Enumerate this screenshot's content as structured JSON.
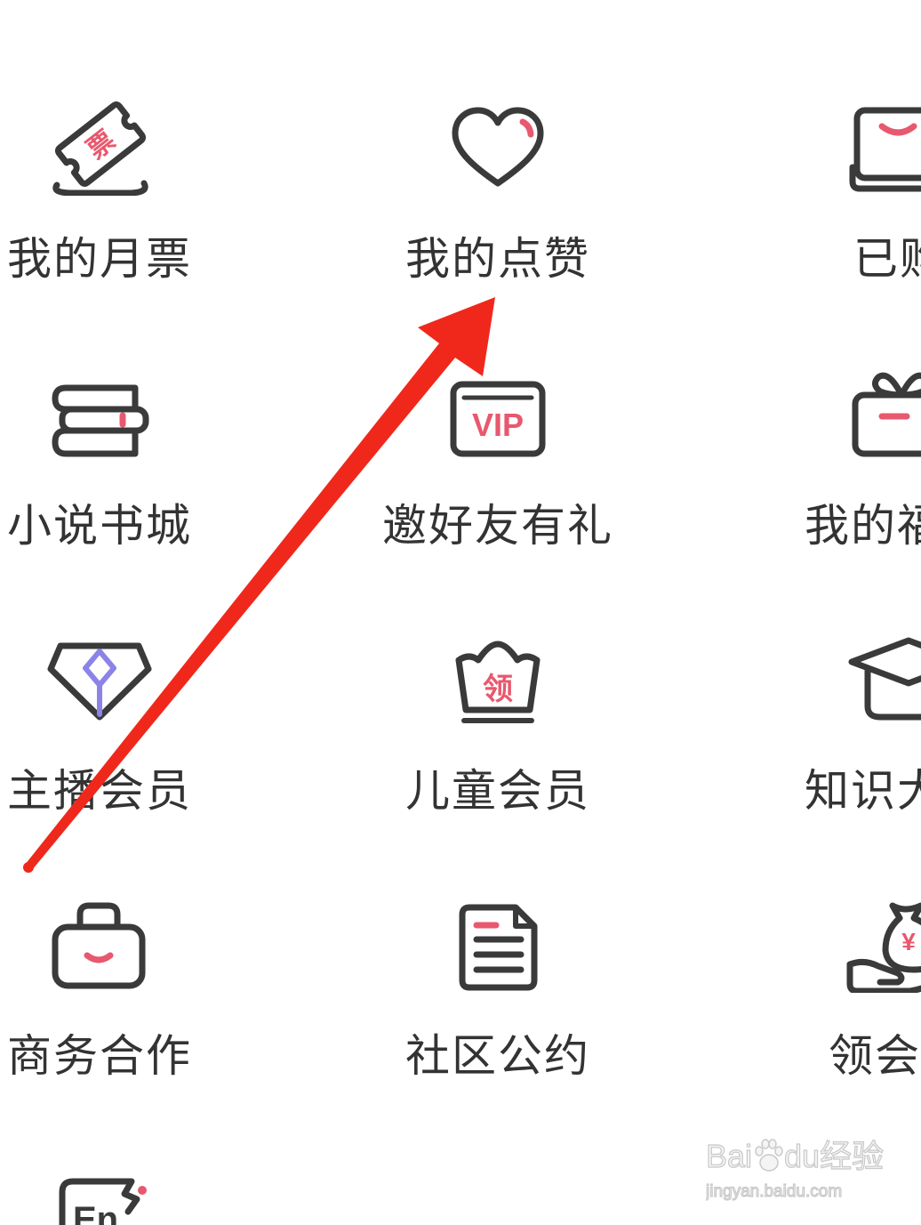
{
  "colors": {
    "stroke": "#3a3a3a",
    "accent": "#e8586e",
    "purple": "#8c83e8",
    "arrow": "#f0281c",
    "text": "#333333",
    "watermark": "#c9c9c9"
  },
  "menu": {
    "items": [
      {
        "label": "我的月票",
        "icon": "ticket-icon",
        "badge": "票"
      },
      {
        "label": "我的点赞",
        "icon": "heart-icon"
      },
      {
        "label": "已购",
        "icon": "purchased-book-icon"
      },
      {
        "label": "小说书城",
        "icon": "books-icon"
      },
      {
        "label": "邀好友有礼",
        "icon": "vip-card-icon",
        "badge": "VIP"
      },
      {
        "label": "我的福",
        "icon": "gift-icon"
      },
      {
        "label": "主播会员",
        "icon": "diamond-icon"
      },
      {
        "label": "儿童会员",
        "icon": "crown-basket-icon",
        "badge": "领"
      },
      {
        "label": "知识大",
        "icon": "graduation-cap-icon"
      },
      {
        "label": "商务合作",
        "icon": "briefcase-icon"
      },
      {
        "label": "社区公约",
        "icon": "document-icon"
      },
      {
        "label": "领会",
        "icon": "money-hand-icon",
        "badge": "¥"
      },
      {
        "icon": "english-icon",
        "badge": "En"
      }
    ]
  },
  "annotation": {
    "icon": "red-arrow-icon"
  },
  "watermark": {
    "part1": "Bai",
    "part2": "du",
    "part3": "经验",
    "url": "jingyan.baidu.com",
    "logo_icon": "paw-logo-icon"
  }
}
